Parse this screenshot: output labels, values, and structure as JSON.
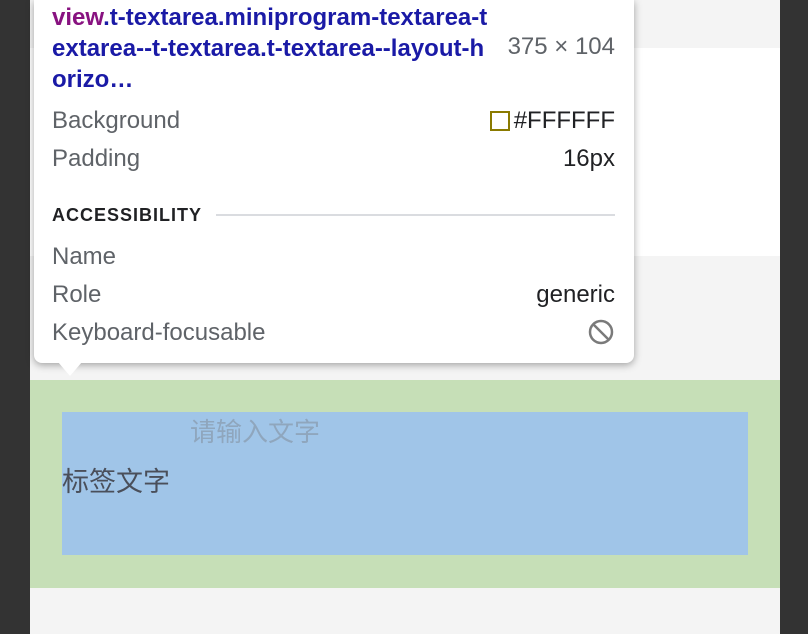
{
  "tooltip": {
    "selector_tag": "view",
    "selector_classes": ".t-textarea.miniprogram-textarea-textarea--t-textarea.t-textarea--layout-horizo…",
    "dimensions": "375 × 104",
    "background_label": "Background",
    "background_value": "#FFFFFF",
    "padding_label": "Padding",
    "padding_value": "16px",
    "accessibility_title": "ACCESSIBILITY",
    "name_label": "Name",
    "name_value": "",
    "role_label": "Role",
    "role_value": "generic",
    "keyboard_label": "Keyboard-focusable",
    "keyboard_icon": "no-entry-icon"
  },
  "page": {
    "label": "标签文字",
    "placeholder": "请输入文字"
  },
  "colors": {
    "padding_highlight": "#c6dfb7",
    "content_highlight": "#a0c5e8",
    "selector_tag": "#881280",
    "selector_class": "#1a1aa6"
  }
}
